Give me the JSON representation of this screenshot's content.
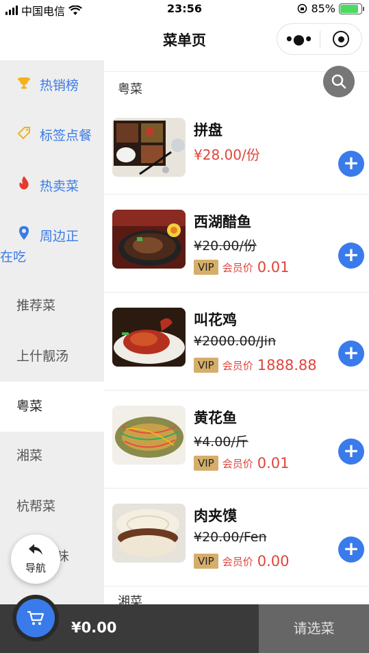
{
  "status_bar": {
    "carrier": "中国电信",
    "time": "23:56",
    "battery": "85%"
  },
  "nav": {
    "title": "菜单页",
    "more_icon": "more-dots-icon",
    "target_icon": "target-icon"
  },
  "sidebar": {
    "items": [
      {
        "label": "热销榜",
        "icon": "trophy-icon"
      },
      {
        "label": "标签点餐",
        "icon": "tag-icon"
      },
      {
        "label": "热卖菜",
        "icon": "flame-icon"
      },
      {
        "label": "周边正",
        "label_line2": "在吃",
        "icon": "location-pin-icon"
      },
      {
        "label": "推荐菜"
      },
      {
        "label": "上什靓汤"
      },
      {
        "label": "粤菜"
      },
      {
        "label": "湘菜"
      },
      {
        "label": "杭帮菜"
      },
      {
        "label": "味"
      }
    ],
    "active": "粤菜",
    "colors": {
      "blue": "#3b7be8",
      "trophy": "#f2b21a",
      "tag": "#f2b21a",
      "flame": "#e53b2c",
      "pin": "#3b7be8"
    }
  },
  "main": {
    "section_current": "粤菜",
    "section_next": "湘菜",
    "search_icon": "search-icon",
    "dishes": [
      {
        "name": "拼盘",
        "price": "¥28.00/份",
        "vip": false
      },
      {
        "name": "西湖醋鱼",
        "original_price": "¥20.00/份",
        "vip": true,
        "vip_badge": "VIP",
        "vip_label": "会员价",
        "vip_price": "0.01"
      },
      {
        "name": "叫花鸡",
        "original_price": "¥2000.00/Jin",
        "vip": true,
        "vip_badge": "VIP",
        "vip_label": "会员价",
        "vip_price": "1888.88"
      },
      {
        "name": "黄花鱼",
        "original_price": "¥4.00/斤",
        "vip": true,
        "vip_badge": "VIP",
        "vip_label": "会员价",
        "vip_price": "0.01"
      },
      {
        "name": "肉夹馍",
        "original_price": "¥20.00/Fen",
        "vip": true,
        "vip_badge": "VIP",
        "vip_label": "会员价",
        "vip_price": "0.00"
      }
    ],
    "add_label": "+"
  },
  "float_nav": {
    "label": "导航",
    "icon": "back-arrow-icon"
  },
  "bottom_bar": {
    "total": "¥0.00",
    "checkout_label": "请选菜",
    "cart_icon": "cart-icon"
  }
}
